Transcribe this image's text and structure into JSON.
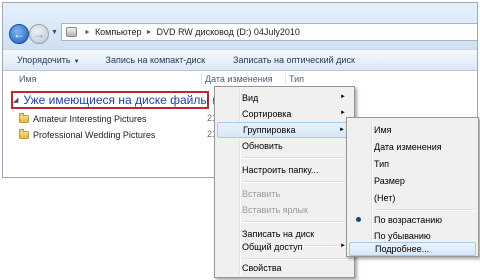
{
  "address": {
    "crumbs": [
      "Компьютер",
      "DVD RW дисковод (D:) 04July2010"
    ]
  },
  "toolbar": {
    "organize": "Упорядочить",
    "burn_cd": "Запись на компакт-диск",
    "burn_optical": "Записать на оптический диск"
  },
  "columns": {
    "name": "Имя",
    "date": "Дата изменения",
    "type": "Тип"
  },
  "group": {
    "header": "Уже имеющиеся на диске файлы (2)"
  },
  "files": [
    {
      "name": "Amateur Interesting Pictures",
      "date": "21."
    },
    {
      "name": "Professional Wedding Pictures",
      "date": "21."
    }
  ],
  "context_menu": {
    "view": "Вид",
    "sort": "Сортировка",
    "group": "Группировка",
    "refresh": "Обновить",
    "customize": "Настроить папку...",
    "paste": "Вставить",
    "paste_shortcut": "Вставить ярлык",
    "burn": "Записать на диск",
    "share": "Общий доступ",
    "properties": "Свойства"
  },
  "group_submenu": {
    "name": "Имя",
    "date": "Дата изменения",
    "type": "Тип",
    "size": "Размер",
    "none": "(Нет)",
    "ascending": "По возрастанию",
    "descending": "По убыванию",
    "more": "Подробнее..."
  }
}
